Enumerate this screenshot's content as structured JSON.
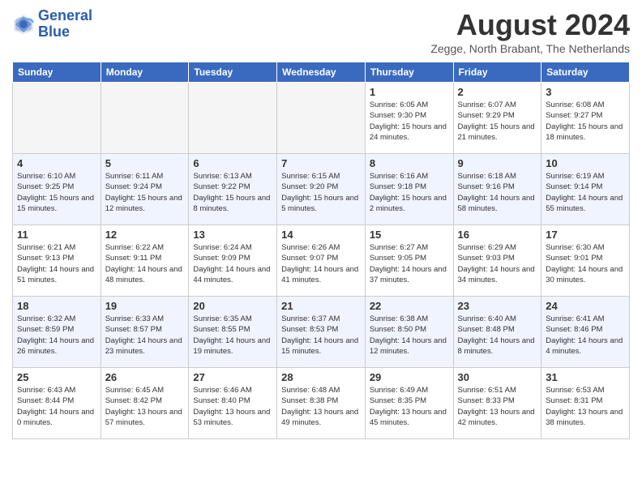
{
  "logo": {
    "line1": "General",
    "line2": "Blue"
  },
  "title": "August 2024",
  "location": "Zegge, North Brabant, The Netherlands",
  "days_of_week": [
    "Sunday",
    "Monday",
    "Tuesday",
    "Wednesday",
    "Thursday",
    "Friday",
    "Saturday"
  ],
  "weeks": [
    [
      {
        "day": "",
        "info": ""
      },
      {
        "day": "",
        "info": ""
      },
      {
        "day": "",
        "info": ""
      },
      {
        "day": "",
        "info": ""
      },
      {
        "day": "1",
        "info": "Sunrise: 6:05 AM\nSunset: 9:30 PM\nDaylight: 15 hours and 24 minutes."
      },
      {
        "day": "2",
        "info": "Sunrise: 6:07 AM\nSunset: 9:29 PM\nDaylight: 15 hours and 21 minutes."
      },
      {
        "day": "3",
        "info": "Sunrise: 6:08 AM\nSunset: 9:27 PM\nDaylight: 15 hours and 18 minutes."
      }
    ],
    [
      {
        "day": "4",
        "info": "Sunrise: 6:10 AM\nSunset: 9:25 PM\nDaylight: 15 hours and 15 minutes."
      },
      {
        "day": "5",
        "info": "Sunrise: 6:11 AM\nSunset: 9:24 PM\nDaylight: 15 hours and 12 minutes."
      },
      {
        "day": "6",
        "info": "Sunrise: 6:13 AM\nSunset: 9:22 PM\nDaylight: 15 hours and 8 minutes."
      },
      {
        "day": "7",
        "info": "Sunrise: 6:15 AM\nSunset: 9:20 PM\nDaylight: 15 hours and 5 minutes."
      },
      {
        "day": "8",
        "info": "Sunrise: 6:16 AM\nSunset: 9:18 PM\nDaylight: 15 hours and 2 minutes."
      },
      {
        "day": "9",
        "info": "Sunrise: 6:18 AM\nSunset: 9:16 PM\nDaylight: 14 hours and 58 minutes."
      },
      {
        "day": "10",
        "info": "Sunrise: 6:19 AM\nSunset: 9:14 PM\nDaylight: 14 hours and 55 minutes."
      }
    ],
    [
      {
        "day": "11",
        "info": "Sunrise: 6:21 AM\nSunset: 9:13 PM\nDaylight: 14 hours and 51 minutes."
      },
      {
        "day": "12",
        "info": "Sunrise: 6:22 AM\nSunset: 9:11 PM\nDaylight: 14 hours and 48 minutes."
      },
      {
        "day": "13",
        "info": "Sunrise: 6:24 AM\nSunset: 9:09 PM\nDaylight: 14 hours and 44 minutes."
      },
      {
        "day": "14",
        "info": "Sunrise: 6:26 AM\nSunset: 9:07 PM\nDaylight: 14 hours and 41 minutes."
      },
      {
        "day": "15",
        "info": "Sunrise: 6:27 AM\nSunset: 9:05 PM\nDaylight: 14 hours and 37 minutes."
      },
      {
        "day": "16",
        "info": "Sunrise: 6:29 AM\nSunset: 9:03 PM\nDaylight: 14 hours and 34 minutes."
      },
      {
        "day": "17",
        "info": "Sunrise: 6:30 AM\nSunset: 9:01 PM\nDaylight: 14 hours and 30 minutes."
      }
    ],
    [
      {
        "day": "18",
        "info": "Sunrise: 6:32 AM\nSunset: 8:59 PM\nDaylight: 14 hours and 26 minutes."
      },
      {
        "day": "19",
        "info": "Sunrise: 6:33 AM\nSunset: 8:57 PM\nDaylight: 14 hours and 23 minutes."
      },
      {
        "day": "20",
        "info": "Sunrise: 6:35 AM\nSunset: 8:55 PM\nDaylight: 14 hours and 19 minutes."
      },
      {
        "day": "21",
        "info": "Sunrise: 6:37 AM\nSunset: 8:53 PM\nDaylight: 14 hours and 15 minutes."
      },
      {
        "day": "22",
        "info": "Sunrise: 6:38 AM\nSunset: 8:50 PM\nDaylight: 14 hours and 12 minutes."
      },
      {
        "day": "23",
        "info": "Sunrise: 6:40 AM\nSunset: 8:48 PM\nDaylight: 14 hours and 8 minutes."
      },
      {
        "day": "24",
        "info": "Sunrise: 6:41 AM\nSunset: 8:46 PM\nDaylight: 14 hours and 4 minutes."
      }
    ],
    [
      {
        "day": "25",
        "info": "Sunrise: 6:43 AM\nSunset: 8:44 PM\nDaylight: 14 hours and 0 minutes."
      },
      {
        "day": "26",
        "info": "Sunrise: 6:45 AM\nSunset: 8:42 PM\nDaylight: 13 hours and 57 minutes."
      },
      {
        "day": "27",
        "info": "Sunrise: 6:46 AM\nSunset: 8:40 PM\nDaylight: 13 hours and 53 minutes."
      },
      {
        "day": "28",
        "info": "Sunrise: 6:48 AM\nSunset: 8:38 PM\nDaylight: 13 hours and 49 minutes."
      },
      {
        "day": "29",
        "info": "Sunrise: 6:49 AM\nSunset: 8:35 PM\nDaylight: 13 hours and 45 minutes."
      },
      {
        "day": "30",
        "info": "Sunrise: 6:51 AM\nSunset: 8:33 PM\nDaylight: 13 hours and 42 minutes."
      },
      {
        "day": "31",
        "info": "Sunrise: 6:53 AM\nSunset: 8:31 PM\nDaylight: 13 hours and 38 minutes."
      }
    ]
  ]
}
